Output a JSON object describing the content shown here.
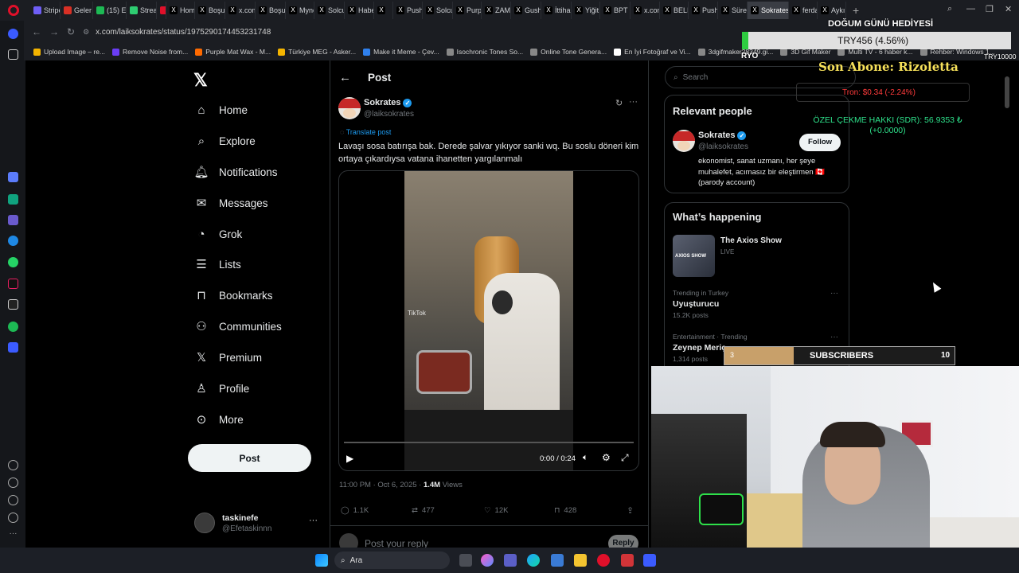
{
  "browser": {
    "tabs": [
      {
        "label": "Stripe",
        "color": "#6f5ef6"
      },
      {
        "label": "Geler",
        "color": "#d93025"
      },
      {
        "label": "(15) E",
        "color": "#1db954"
      },
      {
        "label": "Stream",
        "color": "#2ecc71"
      },
      {
        "label": "",
        "color": "#e0102a"
      },
      {
        "label": "Home",
        "color": "#000000"
      },
      {
        "label": "Boşuı",
        "color": "#000000"
      },
      {
        "label": "x.com",
        "color": "#000000"
      },
      {
        "label": "Boşuı",
        "color": "#000000"
      },
      {
        "label": "Myne",
        "color": "#000000"
      },
      {
        "label": "Solcu",
        "color": "#000000"
      },
      {
        "label": "Habe",
        "color": "#000000"
      },
      {
        "label": "",
        "color": "#000000"
      },
      {
        "label": "Push",
        "color": "#000000"
      },
      {
        "label": "Solcu",
        "color": "#000000"
      },
      {
        "label": "Purpl",
        "color": "#000000"
      },
      {
        "label": "ZAM",
        "color": "#000000"
      },
      {
        "label": "Gush",
        "color": "#000000"
      },
      {
        "label": "İttiha",
        "color": "#000000"
      },
      {
        "label": "Yiğit",
        "color": "#000000"
      },
      {
        "label": "BPT c",
        "color": "#000000"
      },
      {
        "label": "x.com",
        "color": "#000000"
      },
      {
        "label": "BELIT",
        "color": "#000000"
      },
      {
        "label": "Push",
        "color": "#000000"
      },
      {
        "label": "Sürey",
        "color": "#000000"
      },
      {
        "label": "Sokrates c",
        "color": "#000000",
        "active": true
      },
      {
        "label": "ferda",
        "color": "#000000"
      },
      {
        "label": "Aykın",
        "color": "#000000"
      }
    ],
    "url": "x.com/laiksokrates/status/1975290174453231748",
    "bookmarks": [
      {
        "label": "Upload Image – re...",
        "color": "#f4b400"
      },
      {
        "label": "Remove Noise from...",
        "color": "#6a3df5"
      },
      {
        "label": "Purple Mat Wax - M...",
        "color": "#ff6a00"
      },
      {
        "label": "Türkiye MEG - Asker...",
        "color": "#f4b400"
      },
      {
        "label": "Make it Meme - Çev...",
        "color": "#2f80ed"
      },
      {
        "label": "Isochronic Tones So...",
        "color": "#888888"
      },
      {
        "label": "Online Tone Genera...",
        "color": "#888888"
      },
      {
        "label": "En İyi Fotoğraf ve Vi...",
        "color": "#ffffff"
      },
      {
        "label": "3dgifmaker28349.gi...",
        "color": "#888888"
      },
      {
        "label": "3D Gif Maker",
        "color": "#888888"
      },
      {
        "label": "Multi TV - 6 haber k...",
        "color": "#888888"
      },
      {
        "label": "Rehber: Windows 1...",
        "color": "#888888"
      }
    ]
  },
  "nav": {
    "items": [
      {
        "label": "Home",
        "icon": "home-icon"
      },
      {
        "label": "Explore",
        "icon": "search-icon"
      },
      {
        "label": "Notifications",
        "icon": "bell-icon"
      },
      {
        "label": "Messages",
        "icon": "envelope-icon"
      },
      {
        "label": "Grok",
        "icon": "grok-icon"
      },
      {
        "label": "Lists",
        "icon": "list-icon"
      },
      {
        "label": "Bookmarks",
        "icon": "bookmark-icon"
      },
      {
        "label": "Communities",
        "icon": "people-icon"
      },
      {
        "label": "Premium",
        "icon": "x-logo-icon"
      },
      {
        "label": "Profile",
        "icon": "person-icon"
      },
      {
        "label": "More",
        "icon": "more-circle-icon"
      }
    ],
    "post_button": "Post",
    "account": {
      "name": "taskinefe",
      "handle": "@Efetaskinnn"
    }
  },
  "post": {
    "header_title": "Post",
    "author_name": "Sokrates",
    "author_handle": "@laiksokrates",
    "translate_label": "Translate post",
    "text": "Lavaşı sosa batırışa bak. Derede şalvar yıkıyor sanki wq. Bu soslu döneri kim ortaya çıkardıysa vatana ihanetten yargılanmalı",
    "video_time": "0:00 / 0:24",
    "video_watermark": "TikTok",
    "timestamp": "11:00 PM · Oct 6, 2025 · ",
    "views_count": "1.4M",
    "views_label": " Views",
    "replies": "1.1K",
    "reposts": "477",
    "likes": "12K",
    "bookmarks": "428",
    "reply_placeholder": "Post your reply",
    "reply_button": "Reply"
  },
  "right": {
    "search_placeholder": "Search",
    "relevant_title": "Relevant people",
    "person_name": "Sokrates",
    "person_handle": "@laiksokrates",
    "follow_label": "Follow",
    "person_bio": "ekonomist, sanat uzmanı, her şeye muhalefet, acımasız bir eleştirmen 🇨🇦 (parody account)",
    "happening_title": "What’s happening",
    "axios_title": "The Axios Show",
    "axios_status": "LIVE",
    "axios_thumb_text": "AXIOS SHOW",
    "trends": [
      {
        "context": "Trending in Turkey",
        "name": "Uyuşturucu",
        "posts": "15.2K posts"
      },
      {
        "context": "Entertainment · Trending",
        "name": "Zeynep Meriç",
        "posts": "1,314 posts"
      }
    ]
  },
  "stream_overlay": {
    "birthday_gift": "DOĞUM GÜNÜ HEDİYESİ",
    "ticker_try": "TRY456 (4.56%)",
    "ryo": "RYO",
    "try_10000": "TRY10000",
    "last_sub": "Son Abone: Rizoletta",
    "tron": "Tron: $0.34 (-2.24%)",
    "sdr": "ÖZEL ÇEKME HAKKI (SDR): 56.9353 ₺ (+0.0000)",
    "sub_bar_left": "3",
    "sub_bar_title": "SUBSCRIBERS",
    "sub_bar_right": "10",
    "sub_progress": 0.3
  },
  "taskbar": {
    "search_label": "Ara"
  }
}
